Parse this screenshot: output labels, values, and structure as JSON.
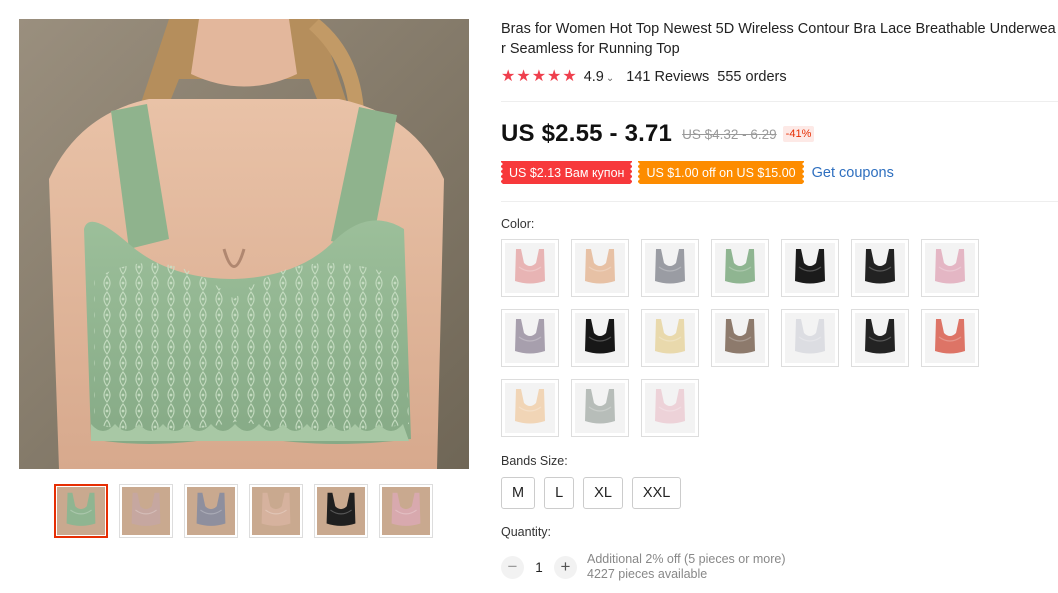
{
  "product": {
    "title": "Bras for Women Hot Top Newest 5D Wireless Contour Bra Lace Breathable Underwear Seamless for Running Top",
    "rating": "4.9",
    "reviews": "141 Reviews",
    "orders": "555 orders",
    "price": "US $2.55 - 3.71",
    "original_price": "US $4.32 - 6.29",
    "discount": "-41%"
  },
  "coupons": {
    "coupon1": "US $2.13 Вам купон",
    "coupon2": "US $1.00 off on US $15.00",
    "get_link": "Get coupons"
  },
  "color": {
    "label": "Color:",
    "options": [
      {
        "name": "pink",
        "color": "#e8b4b4"
      },
      {
        "name": "beige",
        "color": "#e7c1a5"
      },
      {
        "name": "grey",
        "color": "#9a9ca3"
      },
      {
        "name": "green",
        "color": "#8fb591"
      },
      {
        "name": "black-lace",
        "color": "#1b1b1b"
      },
      {
        "name": "black",
        "color": "#222222"
      },
      {
        "name": "light-pink",
        "color": "#e4b6c4"
      },
      {
        "name": "lavender-grey",
        "color": "#a79fad"
      },
      {
        "name": "black-2",
        "color": "#171717"
      },
      {
        "name": "cream",
        "color": "#e9d9ac"
      },
      {
        "name": "brown",
        "color": "#8d7a6c"
      },
      {
        "name": "white-lace",
        "color": "#dcdde2"
      },
      {
        "name": "black-lace-2",
        "color": "#232323"
      },
      {
        "name": "coral",
        "color": "#dd7466"
      },
      {
        "name": "skin-lace",
        "color": "#f1d5b6"
      },
      {
        "name": "grey-lace",
        "color": "#b7bdb9"
      },
      {
        "name": "pink-lace",
        "color": "#edd2d8"
      }
    ]
  },
  "size": {
    "label": "Bands Size:",
    "options": [
      "M",
      "L",
      "XL",
      "XXL"
    ]
  },
  "quantity": {
    "label": "Quantity:",
    "value": "1",
    "note": "Additional 2% off (5 pieces or more)",
    "available": "4227 pieces available"
  },
  "gallery": {
    "thumbnails": [
      {
        "name": "green",
        "color": "#8fb591"
      },
      {
        "name": "pink",
        "color": "#c6a7a0"
      },
      {
        "name": "grey",
        "color": "#8e8f9e"
      },
      {
        "name": "beige",
        "color": "#d6b29e"
      },
      {
        "name": "black",
        "color": "#1f1f1f"
      },
      {
        "name": "pink-lace",
        "color": "#d8a9ae"
      }
    ]
  }
}
